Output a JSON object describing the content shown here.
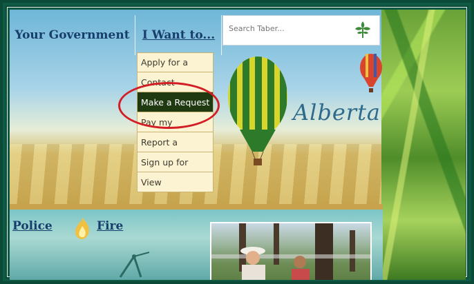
{
  "nav": {
    "tab_government": "Your Government",
    "tab_iwant": "I Want to...",
    "search_placeholder": "Search Taber..."
  },
  "dropdown": {
    "items": [
      "Apply for a",
      "Contact",
      "Make a Request",
      "Pay my",
      "Report a",
      "Sign up for",
      "View"
    ],
    "active_index": 2
  },
  "banner": {
    "script_text": "Alberta"
  },
  "lower": {
    "police_link": "Police",
    "fire_link": "Fire"
  },
  "colors": {
    "highlight_circle": "#d21e24",
    "active_item_bg": "#1f3a10",
    "nav_text": "#173e6b"
  },
  "icons": [
    "search-icon",
    "flame-icon"
  ]
}
